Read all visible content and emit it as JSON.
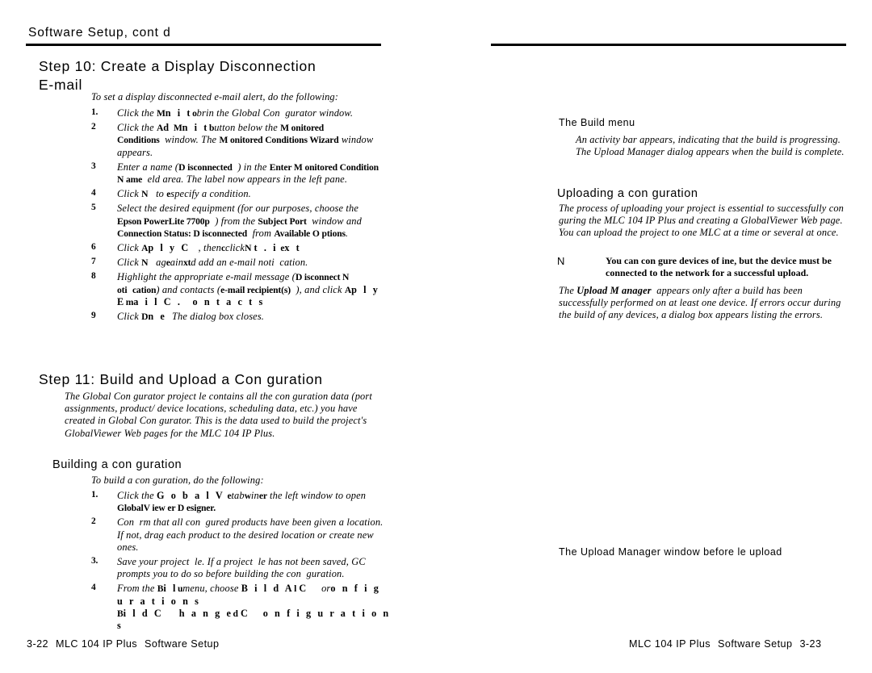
{
  "document": {
    "product": "MLC 104 IP Plus",
    "chapter": "Software Setup",
    "running_head": "Software Setup, cont d"
  },
  "left_page": {
    "number": "3-22",
    "step10": {
      "heading_line1": "Step 10: Create a Display Disconnection",
      "heading_line2": "E-mail",
      "intro": "To set a display disconnected e-mail alert, do the following:",
      "items": [
        {
          "num": "1.",
          "html": "<i>Click the </i><span class=\"ui-tight\">M</span><span class=\"ui\">n i t</span><span class=\"ui-tight\">o</span><i>brin the Global Con</i>&nbsp;&nbsp;<i>gurator window.</i>"
        },
        {
          "num": "2",
          "html": "<i>Click the </i><b>A</b><span class=\"ui\">d</span>&nbsp;<span class=\"ui-tight\">M</span><span class=\"ui\">n i t</span><span class=\"ui-tight\">b</span><i>utton below the </i><b>M onitored Conditions</b>&nbsp;&nbsp;<i>window. The </i><b>M onitored Conditions Wizard</b><i> window appears.</i>"
        },
        {
          "num": "3",
          "html": "<i>Enter a name (</i><b>D isconnected</b>&nbsp;&nbsp;<i>) in the </i><b>Enter M onitored Condition N ame</b>&nbsp;&nbsp;<i>eld area. The label now appears in the left pane.</i>"
        },
        {
          "num": "4",
          "html": "<i>Click </i><span class=\"ui-tight\">N</span>&nbsp;&nbsp;&nbsp;<i>to </i><span class=\"ui-tight\">e</span><i>specify a condition.</i>"
        },
        {
          "num": "5",
          "html": "<i>Select the desired equipment (for our purposes, choose the </i><b>Epson PowerLite 7700p</b>&nbsp;&nbsp;<i>) from the </i><b>Subject Port</b>&nbsp;&nbsp;<i>window and </i><b>Connection Status: D isconnected</b>&nbsp;&nbsp;<i>from </i><b>Available O ptions</b><i>.</i>"
        },
        {
          "num": "6",
          "html": "<i>Click </i><b>A</b><span class=\"ui\">p l y  C</span>&nbsp;&nbsp;&nbsp;<i>, then</i><span class=\"ui-tight\">c</span><i>click</i><span class=\"ui-tight\">N</span>&nbsp;<span class=\"ui\">t . i</span>&nbsp;<span class=\"ui-tight\">e</span><span class=\"ui\">x t</span>"
        },
        {
          "num": "7",
          "html": "<i>Click </i><span class=\"ui-tight\">N</span>&nbsp;&nbsp;&nbsp;<i>ag</i><span class=\"ui-tight\">e</span><i>ain</i><span class=\"ui-tight\">xt</span><i>d add an e-mail noti</i>&nbsp;&nbsp;<i>cation.</i>"
        },
        {
          "num": "8",
          "html": "<i>Highlight the appropriate e-mail message (</i><b>D isconnect N oti</b>&nbsp;&nbsp;<b>cation</b><i>) and contacts (</i><b>e-mail recipient(s)</b>&nbsp;&nbsp;<i>), and click </i><b>A</b><span class=\"ui\">p l y  E</span><span class=\"ui-tight\">m</span><span class=\"ui\">a i l  C .</span>&nbsp;&nbsp;&nbsp;&nbsp;<span class=\"ui\">o n t a c t s</span>"
        },
        {
          "num": "9",
          "html": "<i>Click </i><b>D</b><span class=\"ui\">n e</span>&nbsp;&nbsp;<i>The dialog box closes.</i>"
        }
      ]
    },
    "step11": {
      "heading": "Step 11: Build and Upload a Con  guration",
      "intro": "The Global Con  gurator project  le contains all the con  guration data (port assignments, product/ device locations, scheduling data, etc.) you have created in Global Con  gurator. This is the data used to build the project's GlobalViewer Web pages for the MLC 104 IP Plus.",
      "subheading": "Building a con  guration",
      "list_intro": "To build a con  guration, do the following:",
      "items": [
        {
          "num": "1.",
          "html": "<i>Click the </i><span class=\"ui\">G o b a l  V</span>&nbsp;<span class=\"ui-tight\">e</span><i>tab</i><span class=\"ui-tight\">w</span><i>in</i><span class=\"ui-tight\">er</span><i> the left window to open </i><b>GlobalV iew er D esigner.</b>"
        },
        {
          "num": "2",
          "html": "<i>Con</i>&nbsp;&nbsp;<i>rm that all con</i>&nbsp;&nbsp;<i>gured products have been given a location.  If not, drag each product to the desired location or create new ones.</i>"
        },
        {
          "num": "3.",
          "html": "<i>Save your project</i>&nbsp;&nbsp;<i>le. If a project</i>&nbsp;&nbsp;<i>le has not been saved, GC prompts you to do so before building the con</i>&nbsp;&nbsp;<i>guration.</i>"
        },
        {
          "num": "4",
          "html": "<i>From the </i><b>B</b><span class=\"ui\">i l</span><span class=\"ui-tight\">u</span><i>menu, choose </i><span class=\"ui\">B i l d  A</span><span class=\"ui-tight\">l</span>&nbsp;<span class=\"ui\">C</span>&nbsp;&nbsp;&nbsp;&nbsp;&nbsp;<i>or</i><span class=\"ui\">o n f i g u r a t i o n s</span><br><b>B</b><span class=\"ui\">i l d  C</span>&nbsp;&nbsp;&nbsp;&nbsp;&nbsp;&nbsp;<span class=\"ui\">h a n g e</span><span class=\"ui-tight\">d</span>&nbsp;<span class=\"ui\">C</span>&nbsp;&nbsp;&nbsp;&nbsp;&nbsp;<span class=\"ui\">o n f i g u r a t i o n s</span>"
        }
      ]
    }
  },
  "right_page": {
    "number": "3-23",
    "figure1_caption": "The Build menu",
    "figure1_followup": "An activity bar appears, indicating that the build is progressing.  The Upload Manager dialog appears when the build is complete.",
    "uploading": {
      "heading": "Uploading a con  guration",
      "intro": "The process of uploading your project is essential to successfully con  guring the MLC 104 IP Plus and creating a GlobalViewer Web page.  You can upload the project to one MLC at a time or several at once.",
      "note_tag": "N",
      "note_body": "You can con  gure devices of  ine, but the device must be connected to the network for a successful upload.",
      "body": "The <b>Upload M anager</b>&nbsp;&nbsp;appears only after a build has been successfully performed on at least one device.  If errors occur during the build of any devices, a dialog box appears listing the errors."
    },
    "figure2_caption": "The Upload Manager window before  le upload"
  }
}
